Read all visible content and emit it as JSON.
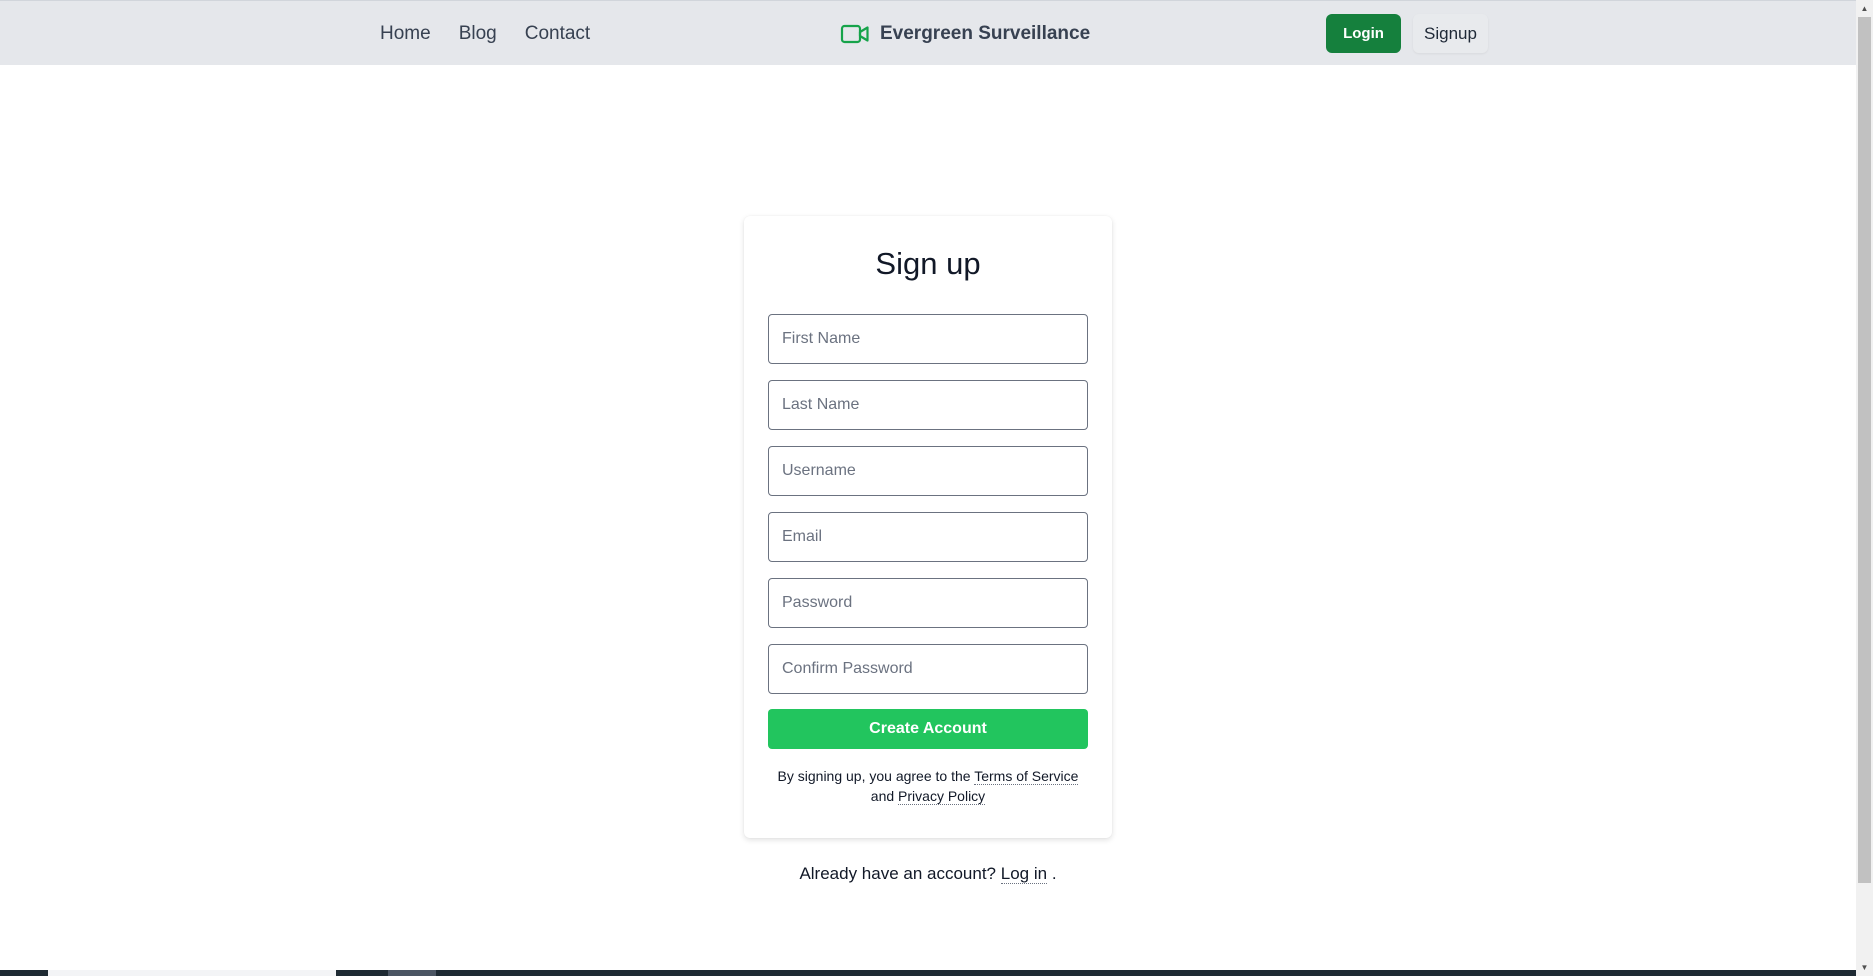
{
  "nav": {
    "links": [
      "Home",
      "Blog",
      "Contact"
    ],
    "brand": {
      "name": "Evergreen Surveillance",
      "icon": "video-camera-icon"
    },
    "login_label": "Login",
    "signup_label": "Signup"
  },
  "signup": {
    "title": "Sign up",
    "fields": {
      "first_name_placeholder": "First Name",
      "last_name_placeholder": "Last Name",
      "username_placeholder": "Username",
      "email_placeholder": "Email",
      "password_placeholder": "Password",
      "confirm_password_placeholder": "Confirm Password"
    },
    "create_button": "Create Account",
    "terms": {
      "prefix": "By signing up, you agree to the",
      "terms_link": "Terms of Service",
      "joiner": "and",
      "privacy_link": "Privacy Policy"
    }
  },
  "footer": {
    "already_text": "Already have an account?",
    "login_link": "Log in",
    "suffix": "."
  },
  "colors": {
    "navbar_bg": "#e5e7eb",
    "login_button": "#15803d",
    "create_button": "#22c55e",
    "brand_icon": "#16a34a"
  }
}
